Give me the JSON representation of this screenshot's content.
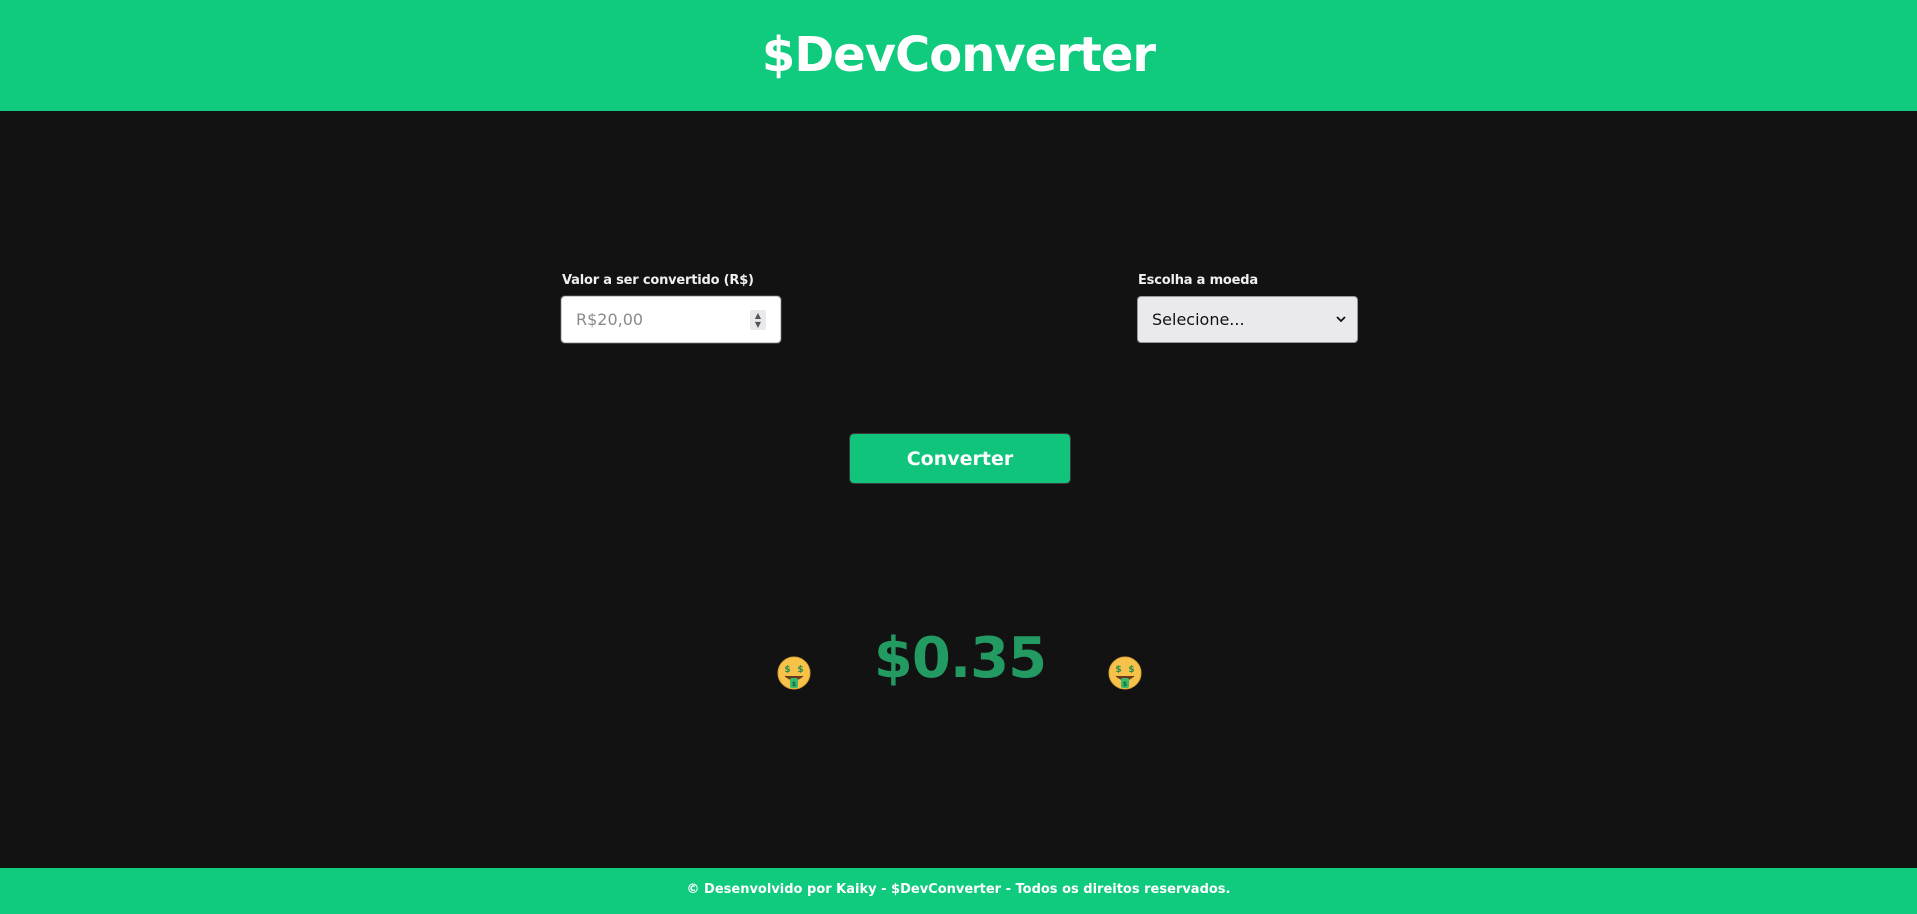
{
  "header": {
    "title": "$DevConverter"
  },
  "form": {
    "amount_label": "Valor a ser convertido (R$)",
    "amount_placeholder": "R$20,00",
    "amount_value": "",
    "currency_label": "Escolha a moeda",
    "currency_selected": "Selecione..."
  },
  "actions": {
    "convert_label": "Converter"
  },
  "result": {
    "value": "$0.35",
    "left_icon": "money-mouth-face-icon",
    "right_icon": "money-mouth-face-icon"
  },
  "footer": {
    "text": "© Desenvolvido por Kaiky - $DevConverter - Todos os direitos reservados."
  },
  "colors": {
    "brand_green": "#10cb7e",
    "result_green": "#239a61",
    "background": "#121212"
  }
}
